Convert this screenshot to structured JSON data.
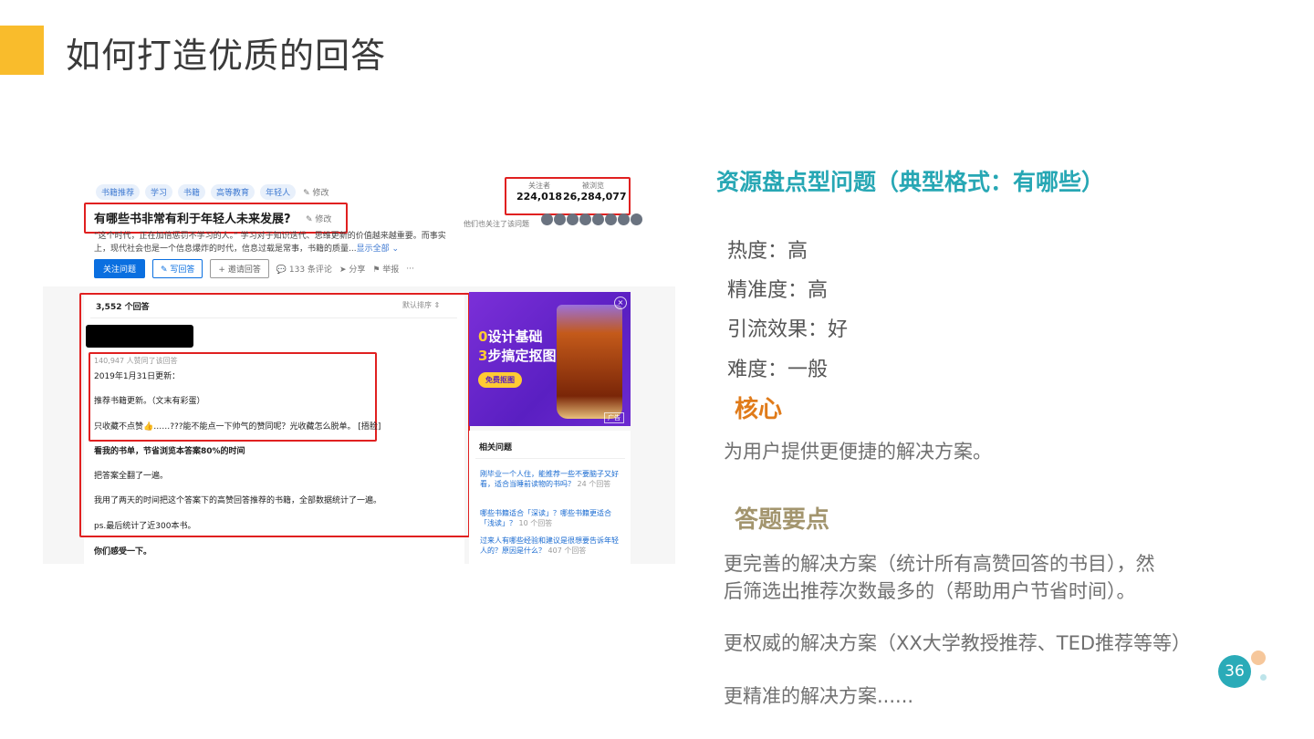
{
  "slide": {
    "title": "如何打造优质的回答",
    "page_number": "36",
    "accent_color": "#f9bc2c"
  },
  "screenshot": {
    "tags": [
      "书籍推荐",
      "学习",
      "书籍",
      "高等教育",
      "年轻人"
    ],
    "tags_edit": "✎ 修改",
    "question_title": "有哪些书非常有利于年轻人未来发展?",
    "question_edit": "✎ 修改",
    "description": "“这个时代，正在加倍惩罚不学习的人。” 学习对于知识迭代、思维更新的价值越来越重要。而事实上，现代社会也是一个信息爆炸的时代，信息过载是常事，书籍的质量...",
    "show_all": "显示全部 ⌄",
    "actions": {
      "follow": "关注问题",
      "write": "✎ 写回答",
      "invite": "+ 邀请回答",
      "comments": "💬 133 条评论",
      "share": "➤ 分享",
      "report": "⚑ 举报",
      "more": "···"
    },
    "stats": {
      "followers_label": "关注者",
      "followers": "224,018",
      "views_label": "被浏览",
      "views": "26,284,077"
    },
    "follow_note": "他们也关注了该问题",
    "answers": {
      "count": "3,552 个回答",
      "sort": "默认排序 ⇕",
      "agree_meta": "140,947 人赞同了该回答",
      "lines": [
        "2019年1月31日更新：",
        "推荐书籍更新。（文末有彩蛋）",
        "只收藏不点赞👍……???能不能点一下帅气的赞同呢？光收藏怎么脱单。 [捂脸]",
        "看我的书单，节省浏览本答案80%的时间",
        "把答案全翻了一遍。",
        "我用了两天的时间把这个答案下的高赞回答推荐的书籍，全部数据统计了一遍。",
        "ps.最后统计了近300本书。",
        "你们感受一下。"
      ]
    },
    "ad": {
      "line1_num": "0",
      "line1": "设计基础",
      "line2_num": "3",
      "line2": "步搞定抠图",
      "button": "免费抠图",
      "close": "×",
      "tag": "广告"
    },
    "related": {
      "title": "相关问题",
      "items": [
        {
          "text": "刚毕业一个人住，能推荐一些不要脑子又好看，适合当睡前读物的书吗？",
          "count": "24 个回答"
        },
        {
          "text": "哪些书籍适合「深读」？哪些书籍更适合「浅读」？",
          "count": "10 个回答"
        },
        {
          "text": "过来人有哪些经验和建议是很想要告诉年轻人的？原因是什么？",
          "count": "407 个回答"
        }
      ]
    }
  },
  "analysis": {
    "heading": "资源盘点型问题（典型格式：有哪些）",
    "metrics": [
      "热度：高",
      "精准度：高",
      "引流效果：好",
      "难度：一般"
    ],
    "core_title": "核心",
    "core_text": "为用户提供更便捷的解决方案。",
    "tips_title": "答题要点",
    "tips": [
      "更完善的解决方案（统计所有高赞回答的书目），然",
      "后筛选出推荐次数最多的（帮助用户节省时间）。",
      "更权威的解决方案（XX大学教授推荐、TED推荐等等）",
      "更精准的解决方案......"
    ]
  }
}
